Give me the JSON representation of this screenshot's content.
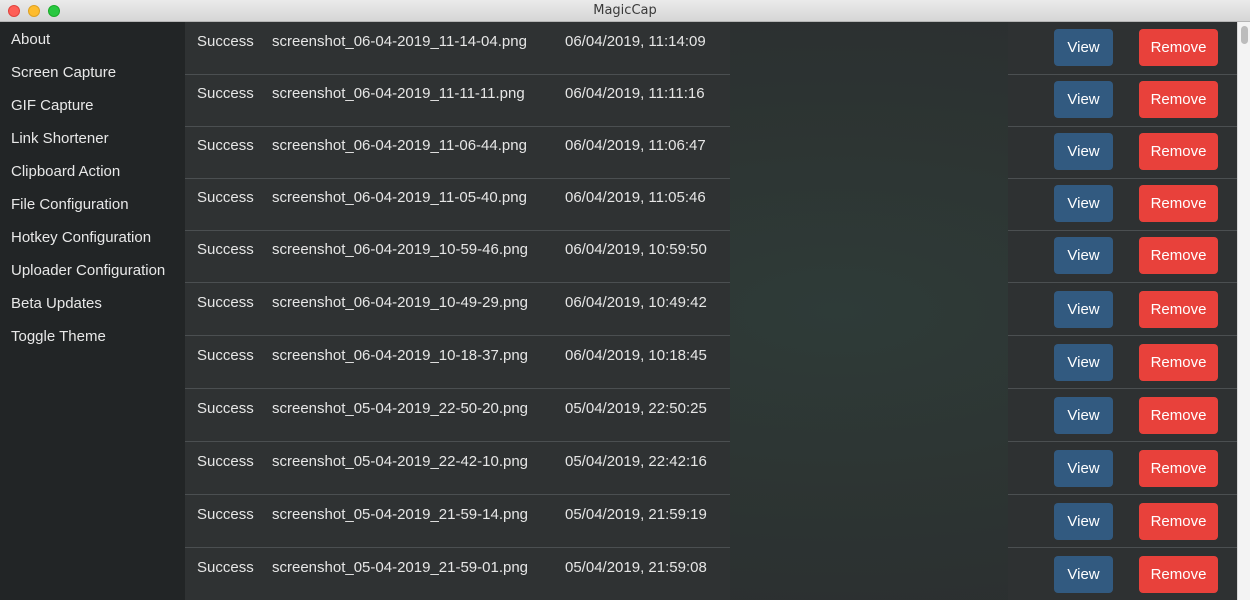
{
  "window": {
    "title": "MagicCap"
  },
  "sidebar": {
    "items": [
      {
        "label": "About"
      },
      {
        "label": "Screen Capture"
      },
      {
        "label": "GIF Capture"
      },
      {
        "label": "Link Shortener"
      },
      {
        "label": "Clipboard Action"
      },
      {
        "label": "File Configuration"
      },
      {
        "label": "Hotkey Configuration"
      },
      {
        "label": "Uploader Configuration"
      },
      {
        "label": "Beta Updates"
      },
      {
        "label": "Toggle Theme"
      }
    ]
  },
  "captures": {
    "view_label": "View",
    "remove_label": "Remove",
    "rows": [
      {
        "status": "Success",
        "file": "screenshot_06-04-2019_11-14-04.png",
        "time": "06/04/2019, 11:14:09"
      },
      {
        "status": "Success",
        "file": "screenshot_06-04-2019_11-11-11.png",
        "time": "06/04/2019, 11:11:16"
      },
      {
        "status": "Success",
        "file": "screenshot_06-04-2019_11-06-44.png",
        "time": "06/04/2019, 11:06:47"
      },
      {
        "status": "Success",
        "file": "screenshot_06-04-2019_11-05-40.png",
        "time": "06/04/2019, 11:05:46"
      },
      {
        "status": "Success",
        "file": "screenshot_06-04-2019_10-59-46.png",
        "time": "06/04/2019, 10:59:50"
      },
      {
        "status": "Success",
        "file": "screenshot_06-04-2019_10-49-29.png",
        "time": "06/04/2019, 10:49:42"
      },
      {
        "status": "Success",
        "file": "screenshot_06-04-2019_10-18-37.png",
        "time": "06/04/2019, 10:18:45"
      },
      {
        "status": "Success",
        "file": "screenshot_05-04-2019_22-50-20.png",
        "time": "05/04/2019, 22:50:25"
      },
      {
        "status": "Success",
        "file": "screenshot_05-04-2019_22-42-10.png",
        "time": "05/04/2019, 22:42:16"
      },
      {
        "status": "Success",
        "file": "screenshot_05-04-2019_21-59-14.png",
        "time": "05/04/2019, 21:59:19"
      },
      {
        "status": "Success",
        "file": "screenshot_05-04-2019_21-59-01.png",
        "time": "05/04/2019, 21:59:08"
      }
    ]
  },
  "colors": {
    "view_button": "#325a80",
    "remove_button": "#e8413b",
    "sidebar_bg": "#222526"
  }
}
